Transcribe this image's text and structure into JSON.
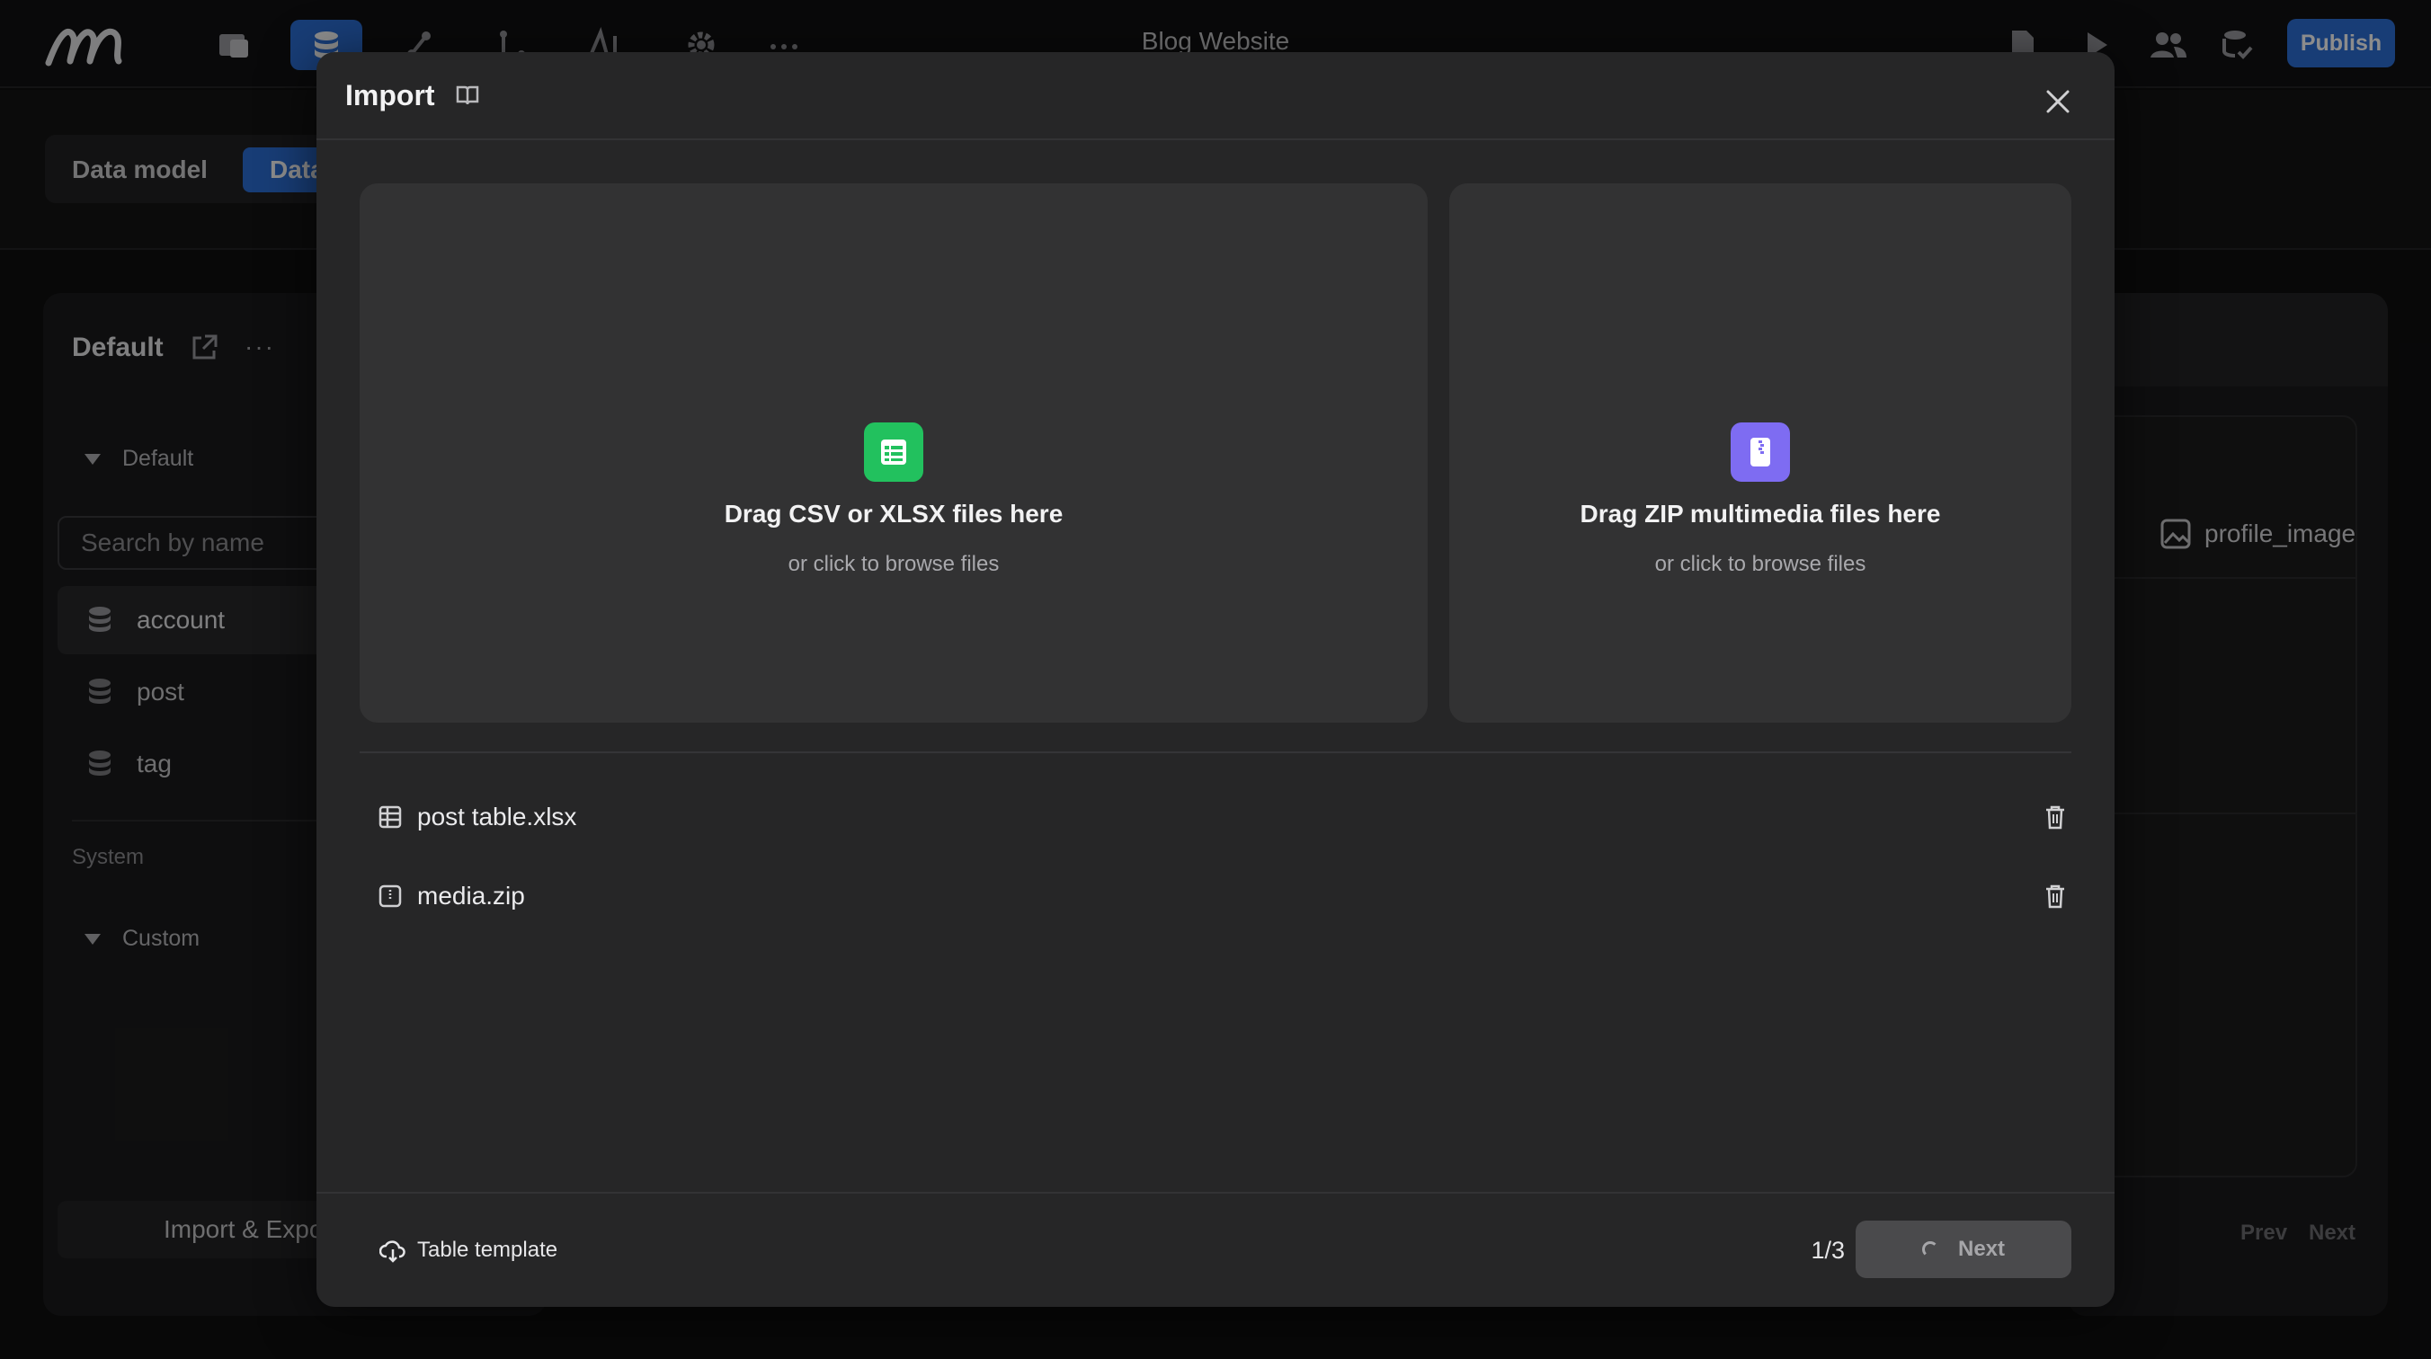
{
  "app": {
    "title": "Blog Website",
    "publish_label": "Publish",
    "toolbar_icons": [
      "pages-icon",
      "database-icon",
      "logic-icon",
      "workflow-icon",
      "ai-icon",
      "settings-icon",
      "more-icon"
    ],
    "active_tool": "database-icon",
    "right_icons": [
      "file-icon",
      "preview-icon",
      "users-icon",
      "db-check-icon"
    ],
    "accent_color": "#2d6fd8"
  },
  "page": {
    "tabs": {
      "data_model": "Data model",
      "data": "Data"
    },
    "left_panel": {
      "title": "Default",
      "more": "···",
      "default_group": "Default",
      "search_placeholder": "Search by name",
      "tables": [
        "account",
        "post",
        "tag"
      ],
      "selected_table": "account",
      "system_label": "System",
      "custom_group": "Custom",
      "import_export_label": "Import & Export"
    },
    "right_panel": {
      "column_label": "profile_image",
      "prev_label": "Prev",
      "next_label": "Next"
    }
  },
  "modal": {
    "title": "Import",
    "dropzones": [
      {
        "title": "Drag CSV or XLSX files here",
        "subtitle": "or click to browse files",
        "icon": "spreadsheet-icon",
        "icon_color": "#22c15e"
      },
      {
        "title": "Drag ZIP multimedia files here",
        "subtitle": "or click to browse files",
        "icon": "zip-file-icon",
        "icon_color": "#7e6cf2"
      }
    ],
    "files": [
      {
        "name": "post table.xlsx",
        "icon": "table-file-icon"
      },
      {
        "name": "media.zip",
        "icon": "zip-file-icon"
      }
    ],
    "footer": {
      "template_label": "Table template",
      "step": "1/3",
      "next_label": "Next"
    }
  }
}
